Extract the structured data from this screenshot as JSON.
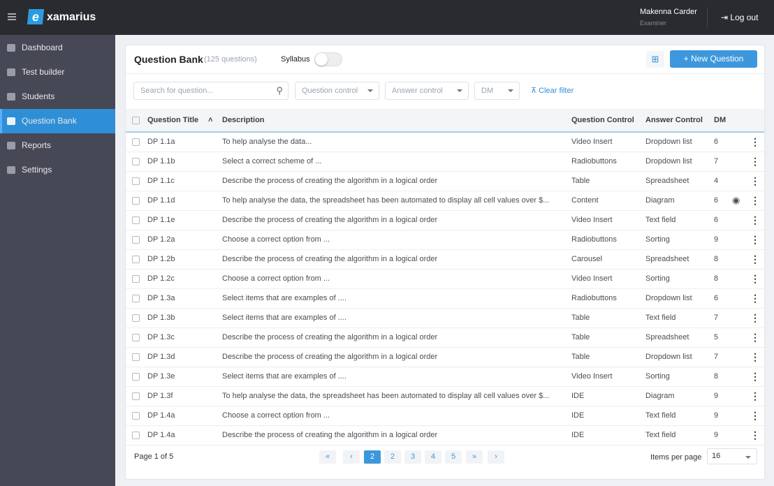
{
  "app": {
    "brand": "xamarius",
    "user_name": "Makenna Carder",
    "user_role": "Examiner",
    "logout": "Log out"
  },
  "sidebar": {
    "items": [
      {
        "label": "Dashboard",
        "icon": "dashboard-icon"
      },
      {
        "label": "Test builder",
        "icon": "test-builder-icon"
      },
      {
        "label": "Students",
        "icon": "people-icon"
      },
      {
        "label": "Question Bank",
        "icon": "question-bank-icon",
        "active": true
      },
      {
        "label": "Reports",
        "icon": "clipboard-icon"
      },
      {
        "label": "Settings",
        "icon": "gear-icon"
      }
    ]
  },
  "header": {
    "title": "Question Bank",
    "count": "(125 questions)",
    "syllabus_label": "Syllabus",
    "syllabus_on": false,
    "new_question": "New Question"
  },
  "filters": {
    "search_placeholder": "Search for question...",
    "question_control": "Question control",
    "answer_control": "Answer control",
    "dm": "DM",
    "clear": "Clear filter"
  },
  "table": {
    "columns": [
      "Question Title",
      "Description",
      "Question Control",
      "Answer Control",
      "DM"
    ],
    "rows": [
      [
        "DP 1.1a",
        "To help analyse the data...",
        "Video Insert",
        "Dropdown list",
        "6"
      ],
      [
        "DP 1.1b",
        "Select a correct scheme of ...",
        "Radiobuttons",
        "Dropdown list",
        "7"
      ],
      [
        "DP 1.1c",
        "Describe the process of creating the algorithm in a logical order",
        "Table",
        "Spreadsheet",
        "4"
      ],
      [
        "DP 1.1d",
        "To help analyse the data, the spreadsheet has been automated to display all cell values over $...",
        "Content",
        "Diagram",
        "6"
      ],
      [
        "DP 1.1e",
        "Describe the process of creating the algorithm in a logical order",
        "Video Insert",
        "Text field",
        "6"
      ],
      [
        "DP 1.2a",
        "Choose a correct option from ...",
        "Radiobuttons",
        "Sorting",
        "9"
      ],
      [
        "DP 1.2b",
        "Describe the process of creating the algorithm in a logical order",
        "Carousel",
        "Spreadsheet",
        "8"
      ],
      [
        "DP 1.2c",
        "Choose a correct option from ...",
        "Video Insert",
        "Sorting",
        "8"
      ],
      [
        "DP 1.3a",
        "Select items that are examples of ....",
        "Radiobuttons",
        "Dropdown list",
        "6"
      ],
      [
        "DP 1.3b",
        "Select items that are examples of ....",
        "Table",
        "Text field",
        "7"
      ],
      [
        "DP 1.3c",
        "Describe the process of creating the algorithm in a logical order",
        "Table",
        "Spreadsheet",
        "5"
      ],
      [
        "DP 1.3d",
        "Describe the process of creating the algorithm in a logical order",
        "Table",
        "Dropdown list",
        "7"
      ],
      [
        "DP 1.3e",
        "Select items that are examples of ....",
        "Video Insert",
        "Sorting",
        "8"
      ],
      [
        "DP 1.3f",
        "To help analyse the data, the spreadsheet has been automated to display all cell values over $...",
        "IDE",
        "Diagram",
        "9"
      ],
      [
        "DP 1.4a",
        "Choose a correct option from ...",
        "IDE",
        "Text field",
        "9"
      ],
      [
        "DP 1.4a",
        "Describe the process of creating the algorithm in a logical order",
        "IDE",
        "Text field",
        "9"
      ]
    ]
  },
  "pagination": {
    "page_text": "Page 1 of 5",
    "first": "«",
    "prev": "‹",
    "pages": [
      "2",
      "2",
      "3",
      "4",
      "5"
    ],
    "next_far": "»",
    "next": "›",
    "items_per_page_label": "Items per page",
    "items_per_page": "16"
  }
}
